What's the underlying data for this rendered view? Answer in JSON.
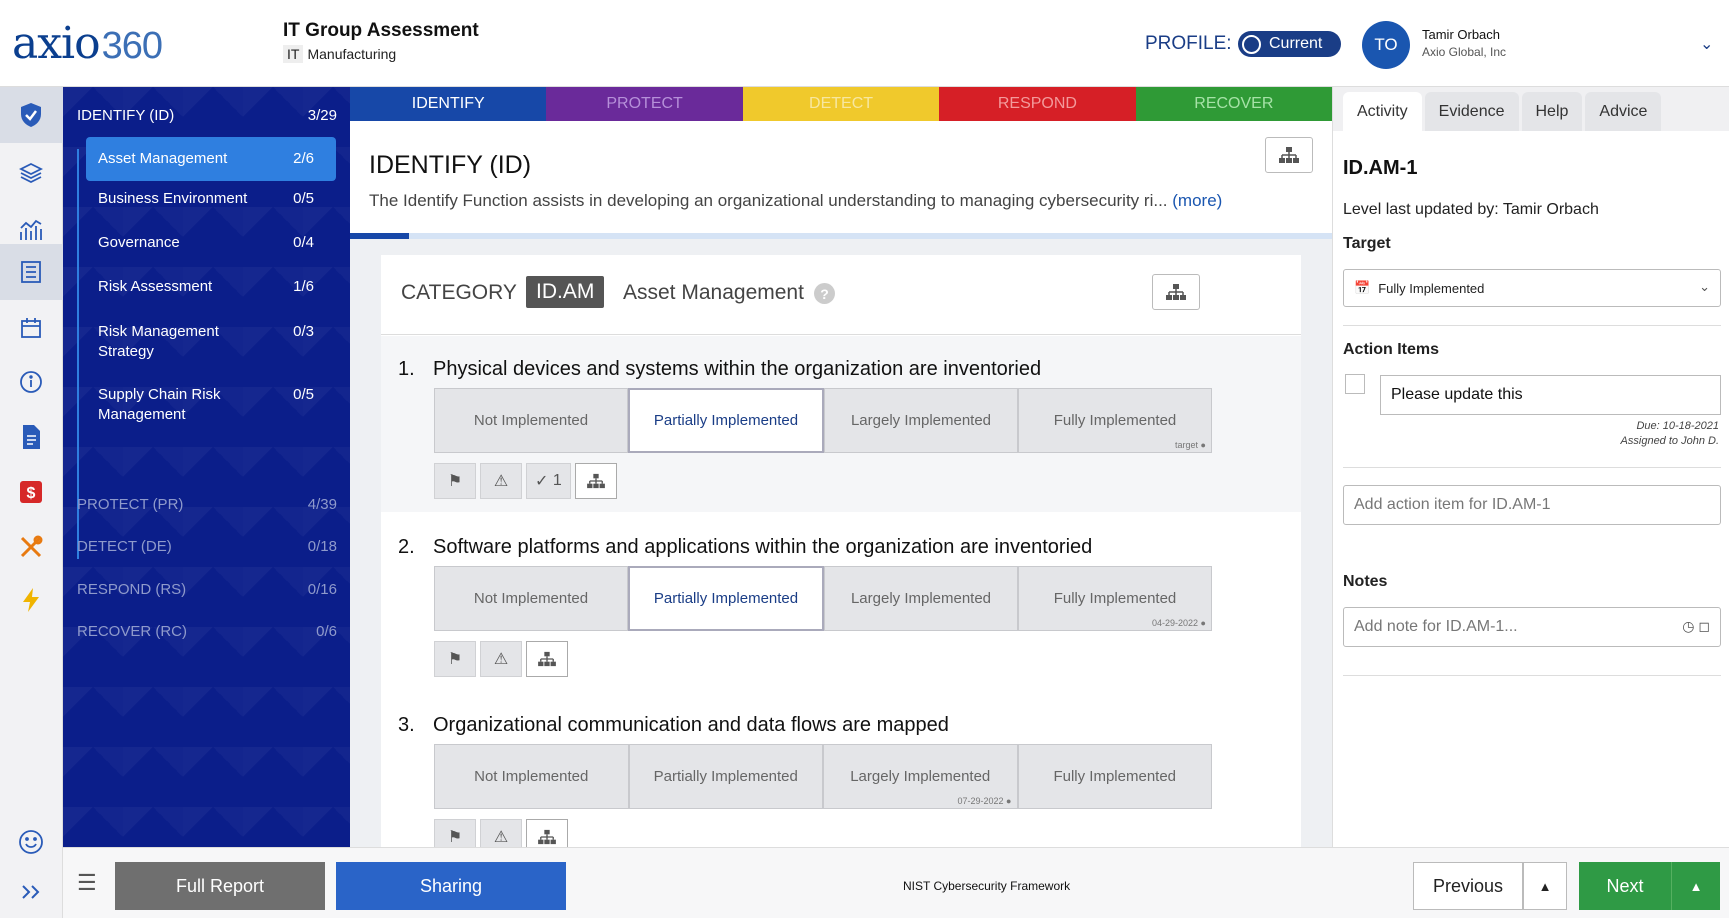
{
  "header": {
    "logo": "axio",
    "logo_num": "360",
    "title": "IT Group Assessment",
    "sub_tag": "IT",
    "sub_text": "Manufacturing",
    "profile_label": "PROFILE:",
    "profile_value": "Current",
    "avatar_initials": "TO",
    "user_name": "Tamir Orbach",
    "user_org": "Axio Global, Inc"
  },
  "nav": {
    "identify_label": "IDENTIFY (ID)",
    "identify_count": "3/29",
    "categories": [
      {
        "label": "Asset Management",
        "count": "2/6"
      },
      {
        "label": "Business Environment",
        "count": "0/5"
      },
      {
        "label": "Governance",
        "count": "0/4"
      },
      {
        "label": "Risk Assessment",
        "count": "1/6"
      },
      {
        "label": "Risk Management Strategy",
        "count": "0/3"
      },
      {
        "label": "Supply Chain Risk Management",
        "count": "0/5"
      }
    ],
    "functions": [
      {
        "label": "PROTECT (PR)",
        "count": "4/39"
      },
      {
        "label": "DETECT (DE)",
        "count": "0/18"
      },
      {
        "label": "RESPOND (RS)",
        "count": "0/16"
      },
      {
        "label": "RECOVER (RC)",
        "count": "0/6"
      }
    ]
  },
  "tabs": [
    "IDENTIFY",
    "PROTECT",
    "DETECT",
    "RESPOND",
    "RECOVER"
  ],
  "main": {
    "fn_title": "IDENTIFY (ID)",
    "fn_desc": "The Identify Function assists in developing an organizational understanding to managing cybersecurity ri...",
    "more": "(more)",
    "progress": 0.06,
    "cat_label": "CATEGORY",
    "cat_chip": "ID.AM",
    "cat_name": "Asset Management",
    "questions": [
      {
        "num": "1.",
        "text": "Physical devices and systems within the organization are inventoried",
        "check_count": "1"
      },
      {
        "num": "2.",
        "text": "Software platforms and applications within the organization are inventoried"
      },
      {
        "num": "3.",
        "text": "Organizational communication and data flows are mapped"
      }
    ],
    "levels": [
      "Not Implemented",
      "Partially Implemented",
      "Largely Implemented",
      "Fully Implemented"
    ],
    "q1_tag": "target ●",
    "q2_tag": "04-29-2022 ●",
    "q3_tag": "07-29-2022 ●"
  },
  "right": {
    "tabs": [
      "Activity",
      "Evidence",
      "Help",
      "Advice"
    ],
    "id": "ID.AM-1",
    "updated": "Level last updated by: Tamir Orbach",
    "target_label": "Target",
    "target_value": "Fully Implemented",
    "action_label": "Action Items",
    "action_text": "Please update this",
    "due": "Due: 10-18-2021",
    "assigned": "Assigned to John D.",
    "add_action_placeholder": "Add action item for ID.AM-1",
    "notes_label": "Notes",
    "note_placeholder": "Add note for ID.AM-1..."
  },
  "footer": {
    "report": "Full Report",
    "sharing": "Sharing",
    "framework": "NIST Cybersecurity Framework",
    "previous": "Previous",
    "next": "Next"
  },
  "colors": {
    "identify": "#1748a8",
    "protect": "#6a2a9a",
    "detect": "#f0c92c",
    "respond": "#d61f26",
    "recover": "#2f9a36"
  }
}
